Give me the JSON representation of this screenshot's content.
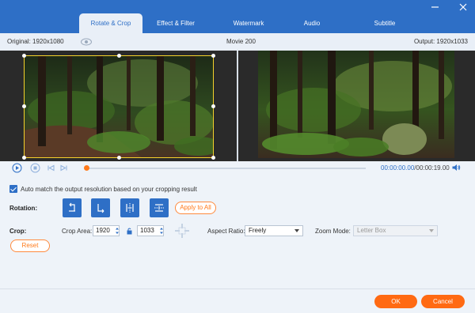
{
  "tabs": [
    {
      "label": "Rotate & Crop",
      "active": true
    },
    {
      "label": "Effect & Filter",
      "active": false
    },
    {
      "label": "Watermark",
      "active": false
    },
    {
      "label": "Audio",
      "active": false
    },
    {
      "label": "Subtitle",
      "active": false
    }
  ],
  "info": {
    "original": "Original: 1920x1080",
    "file_name": "Movie 200",
    "output": "Output: 1920x1033"
  },
  "player": {
    "current_time": "00:00:00.00",
    "total_time": "/00:00:19.00",
    "progress": 0.0
  },
  "options": {
    "auto_match_label": "Auto match the output resolution based on your cropping result",
    "auto_match_checked": true
  },
  "rotation": {
    "label": "Rotation:",
    "apply_all": "Apply to All"
  },
  "crop": {
    "label": "Crop:",
    "area_label": "Crop Area:",
    "width": "1920",
    "height": "1033",
    "aspect_label": "Aspect Ratio:",
    "aspect_value": "Freely",
    "zoom_label": "Zoom Mode:",
    "zoom_value": "Letter Box",
    "reset": "Reset"
  },
  "footer": {
    "ok": "OK",
    "cancel": "Cancel"
  },
  "colors": {
    "accent": "#2e6fc6",
    "orange": "#ff6a13",
    "crop_border": "#f5d22b"
  }
}
